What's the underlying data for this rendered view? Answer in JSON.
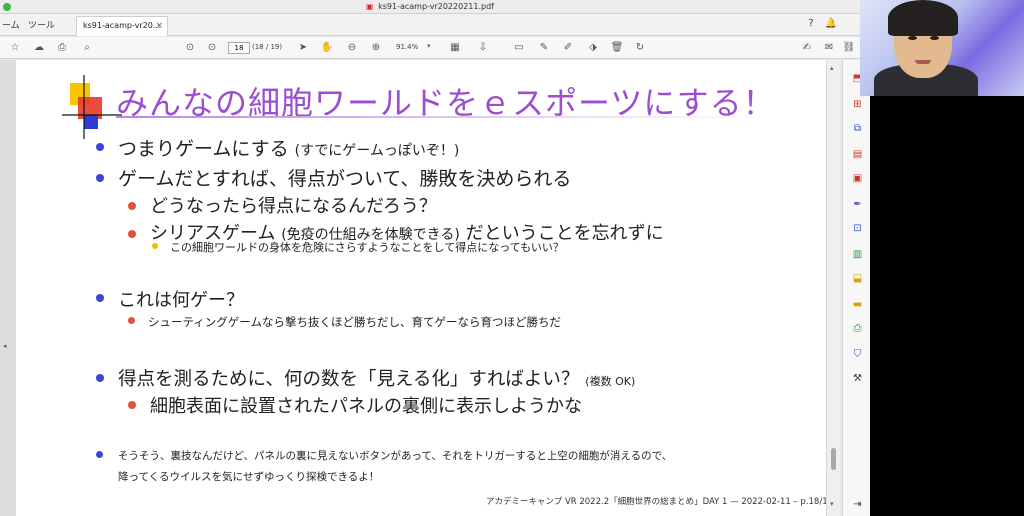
{
  "window": {
    "title": "ks91-acamp-vr20220211.pdf"
  },
  "menu": {
    "items": [
      "ーム",
      "ツール"
    ]
  },
  "tab": {
    "label": "ks91-acamp-vr20...",
    "close": "×"
  },
  "toolbar": {
    "page_number": "18",
    "page_count": "(18 / 19)",
    "zoom": "91.4%"
  },
  "slide": {
    "title": "みんなの細胞ワールドをｅスポーツにする！",
    "items": [
      {
        "main": "つまりゲームにする",
        "note": "(すでにゲームっぽいぞ！)"
      },
      {
        "main": "ゲームだとすれば、得点がついて、勝敗を決められる"
      },
      {
        "main": "どうなったら得点になるんだろう？"
      },
      {
        "main": "シリアスゲーム",
        "note": "(免疫の仕組みを体験できる)",
        "tail": "だということを忘れずに"
      },
      {
        "main": "この細胞ワールドの身体を危険にさらすようなことをして得点になってもいい？"
      },
      {
        "main": "これは何ゲー？"
      },
      {
        "main": "シューティングゲームなら撃ち抜くほど勝ちだし、育てゲーなら育つほど勝ちだ"
      },
      {
        "main": "得点を測るために、何の数を「見える化」すればよい？",
        "note": "(複数 OK)"
      },
      {
        "main": "細胞表面に設置されたパネルの裏側に表示しようかな"
      },
      {
        "main": "そうそう、裏技なんだけど、パネルの裏に見えないボタンがあって、それをトリガーすると上空の細胞が消えるので、",
        "line2": "降ってくるウイルスを気にせずゆっくり探検できるよ！"
      }
    ],
    "footer": "アカデミーキャンプ VR 2022.2「細胞世界の総まとめ」DAY 1 — 2022-02-11 – p.18/19"
  },
  "colors": {
    "title": "#9b4fd0",
    "bullet_blue": "#3b44d8",
    "bullet_red": "#e4503a",
    "bullet_yellow": "#f0c000"
  }
}
